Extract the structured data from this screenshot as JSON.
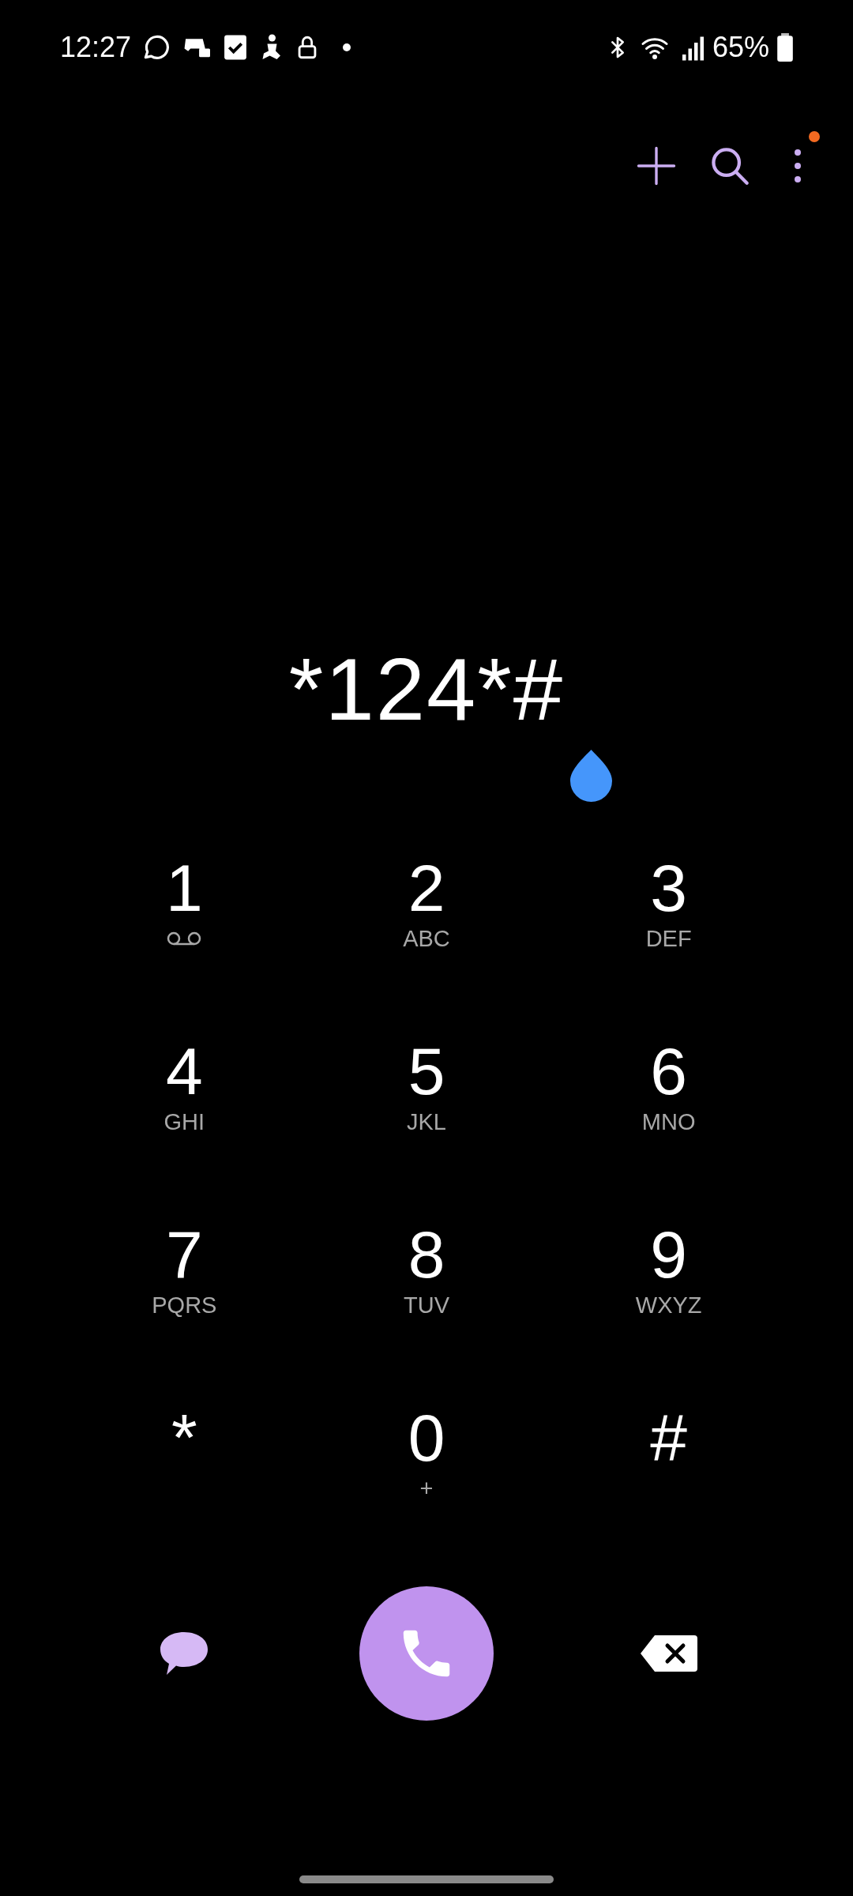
{
  "status_bar": {
    "time": "12:27",
    "battery": "65%"
  },
  "toolbar": {
    "menu_badge": true
  },
  "dialed_number": "*124*#",
  "keys": [
    {
      "digit": "1",
      "kind": "voicemail"
    },
    {
      "digit": "2",
      "kind": "letters",
      "letters": "ABC"
    },
    {
      "digit": "3",
      "kind": "letters",
      "letters": "DEF"
    },
    {
      "digit": "4",
      "kind": "letters",
      "letters": "GHI"
    },
    {
      "digit": "5",
      "kind": "letters",
      "letters": "JKL"
    },
    {
      "digit": "6",
      "kind": "letters",
      "letters": "MNO"
    },
    {
      "digit": "7",
      "kind": "letters",
      "letters": "PQRS"
    },
    {
      "digit": "8",
      "kind": "letters",
      "letters": "TUV"
    },
    {
      "digit": "9",
      "kind": "letters",
      "letters": "WXYZ"
    },
    {
      "digit": "*",
      "kind": "none"
    },
    {
      "digit": "0",
      "kind": "letters",
      "letters": "+"
    },
    {
      "digit": "#",
      "kind": "none"
    }
  ]
}
